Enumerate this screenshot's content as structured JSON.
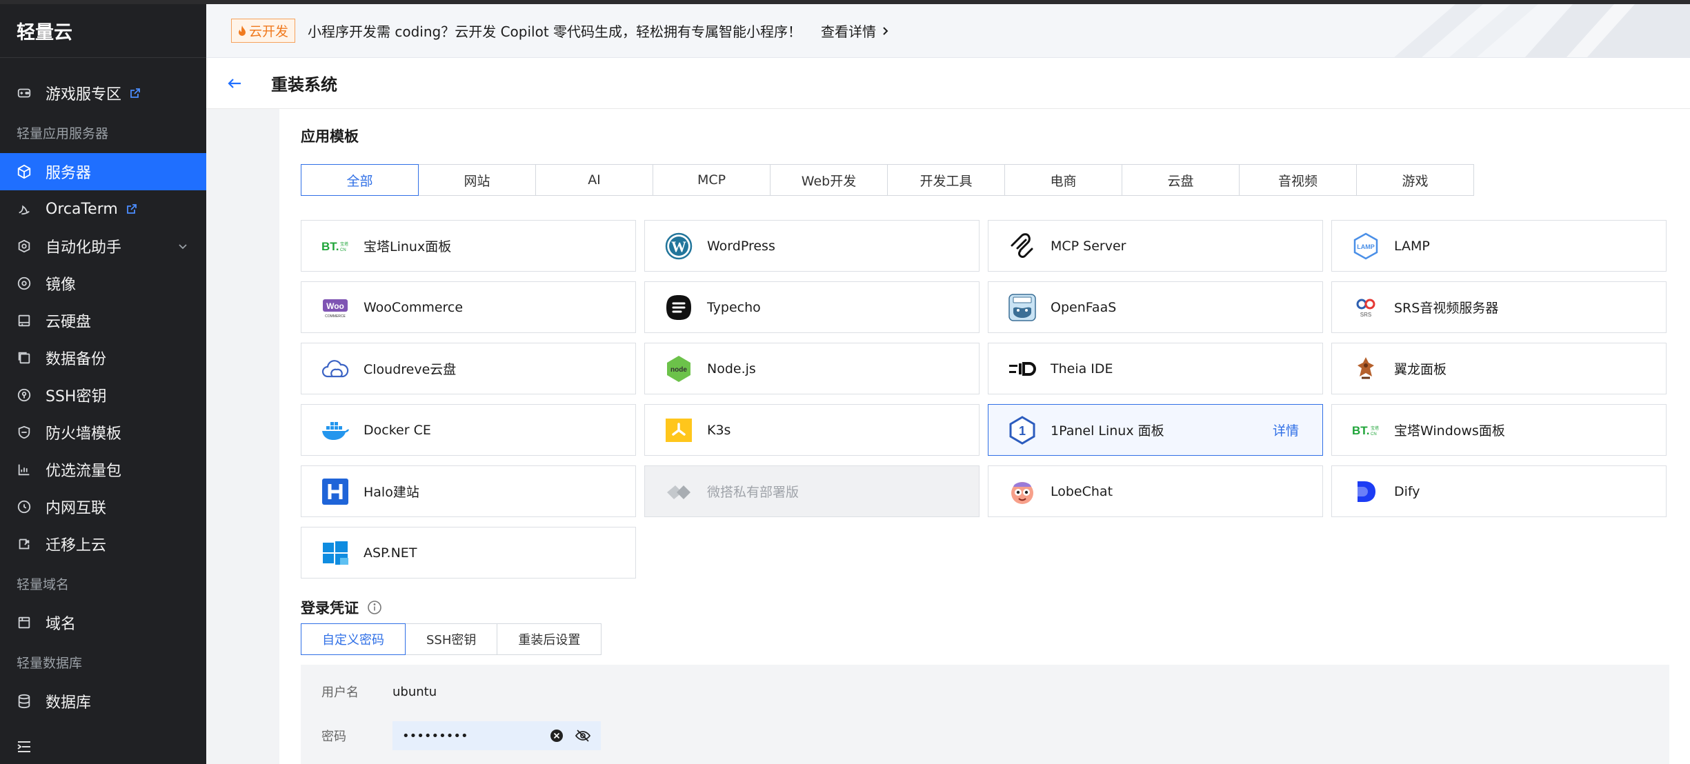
{
  "sidebar": {
    "brand": "轻量云",
    "game_zone": "游戏服专区",
    "section_server": "轻量应用服务器",
    "items": [
      {
        "label": "服务器"
      },
      {
        "label": "OrcaTerm"
      },
      {
        "label": "自动化助手"
      },
      {
        "label": "镜像"
      },
      {
        "label": "云硬盘"
      },
      {
        "label": "数据备份"
      },
      {
        "label": "SSH密钥"
      },
      {
        "label": "防火墙模板"
      },
      {
        "label": "优选流量包"
      },
      {
        "label": "内网互联"
      },
      {
        "label": "迁移上云"
      }
    ],
    "section_domain": "轻量域名",
    "domain": "域名",
    "section_db": "轻量数据库",
    "database": "数据库"
  },
  "banner": {
    "tag": "云开发",
    "text": "小程序开发需 coding？云开发 Copilot 零代码生成，轻松拥有专属智能小程序！",
    "link": "查看详情"
  },
  "header": {
    "title": "重装系统"
  },
  "templates": {
    "title": "应用模板",
    "tabs": [
      "全部",
      "网站",
      "AI",
      "MCP",
      "Web开发",
      "开发工具",
      "电商",
      "云盘",
      "音视频",
      "游戏"
    ],
    "active_tab": "全部",
    "items": [
      {
        "name": "宝塔Linux面板",
        "icon": "bt-logo"
      },
      {
        "name": "WordPress",
        "icon": "wordpress-icon"
      },
      {
        "name": "MCP Server",
        "icon": "mcp-icon"
      },
      {
        "name": "LAMP",
        "icon": "lamp-icon"
      },
      {
        "name": "WooCommerce",
        "icon": "woocommerce-icon"
      },
      {
        "name": "Typecho",
        "icon": "typecho-icon"
      },
      {
        "name": "OpenFaaS",
        "icon": "openfaas-icon"
      },
      {
        "name": "SRS音视频服务器",
        "icon": "srs-icon"
      },
      {
        "name": "Cloudreve云盘",
        "icon": "cloudreve-icon"
      },
      {
        "name": "Node.js",
        "icon": "nodejs-icon"
      },
      {
        "name": "Theia IDE",
        "icon": "theia-icon"
      },
      {
        "name": "翼龙面板",
        "icon": "pterodactyl-icon"
      },
      {
        "name": "Docker CE",
        "icon": "docker-icon"
      },
      {
        "name": "K3s",
        "icon": "k3s-icon"
      },
      {
        "name": "1Panel Linux 面板",
        "icon": "1panel-icon",
        "detail": "详情"
      },
      {
        "name": "宝塔Windows面板",
        "icon": "bt-windows-logo"
      },
      {
        "name": "Halo建站",
        "icon": "halo-icon"
      },
      {
        "name": "微搭私有部署版",
        "icon": "weda-icon"
      },
      {
        "name": "LobeChat",
        "icon": "lobechat-icon"
      },
      {
        "name": "Dify",
        "icon": "dify-icon"
      },
      {
        "name": "ASP.NET",
        "icon": "windows-icon"
      }
    ]
  },
  "login": {
    "title": "登录凭证",
    "tabs": [
      "自定义密码",
      "SSH密钥",
      "重装后设置"
    ],
    "username_label": "用户名",
    "username": "ubuntu",
    "password_label": "密码",
    "password_mask": "•••••••••"
  },
  "colors": {
    "primary": "#1f6fff",
    "sidebar_bg": "#202124",
    "accent_orange": "#f07a1f"
  }
}
